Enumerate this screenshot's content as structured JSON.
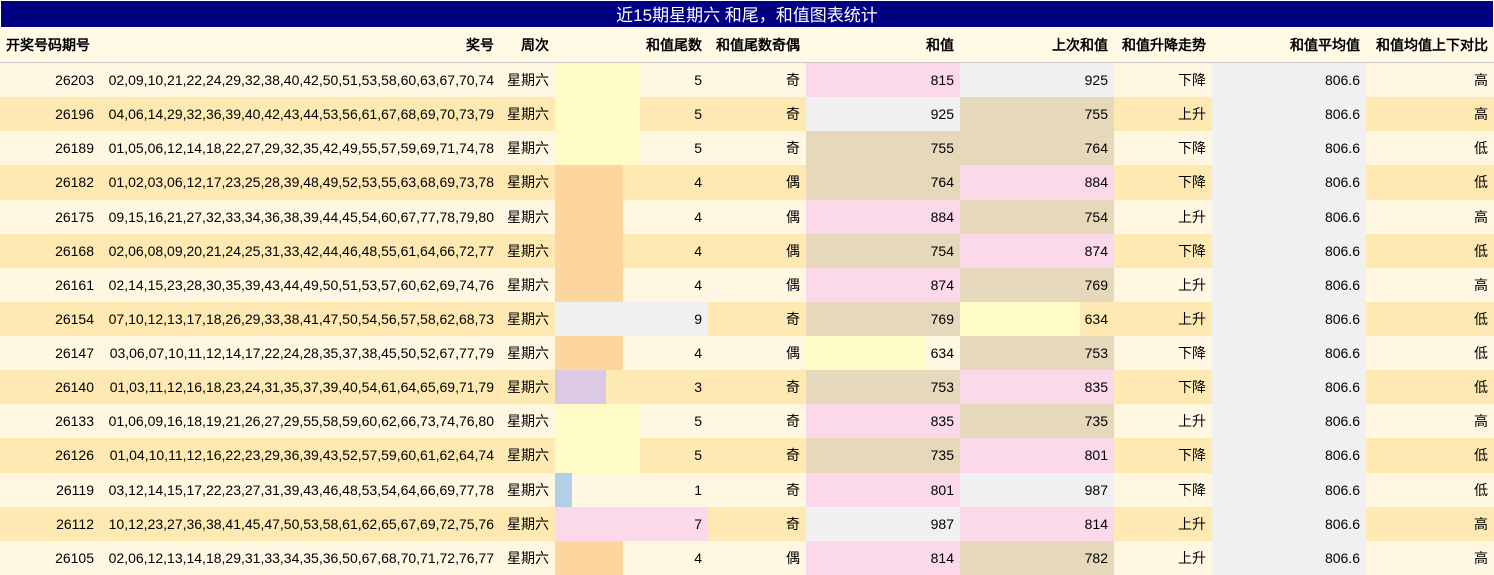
{
  "title": "近15期星期六 和尾，和值图表统计",
  "headers": [
    "开奖号码期号",
    "奖号",
    "周次",
    "",
    "和值尾数",
    "和值尾数奇偶",
    "和值",
    "上次和值",
    "和值升降走势",
    "和值平均值",
    "和值均值上下对比"
  ],
  "colors": {
    "title_bg": "#000080",
    "row_odd": "#fff7e2",
    "row_even": "#fee9b3",
    "tail_1": "#b3cfe6",
    "tail_3": "#dcc9e3",
    "tail_4": "#fdd59e",
    "tail_5": "#fffbc6",
    "tail_7": "#fbd9ea",
    "tail_9": "#f0f0f0",
    "sum_600s": "#fffbc6",
    "sum_700s": "#e6d8bb",
    "sum_800s": "#fbd9ea",
    "sum_900s": "#f0f0f0"
  },
  "rows": [
    {
      "issue": "26203",
      "numbers": "02,09,10,21,22,24,29,32,38,40,42,50,51,53,58,60,63,67,70,74",
      "weekday": "星期六",
      "tail": 5,
      "parity": "奇",
      "sum": 815,
      "prev_sum": 925,
      "trend": "下降",
      "avg": "806.6",
      "compare": "高"
    },
    {
      "issue": "26196",
      "numbers": "04,06,14,29,32,36,39,40,42,43,44,53,56,61,67,68,69,70,73,79",
      "weekday": "星期六",
      "tail": 5,
      "parity": "奇",
      "sum": 925,
      "prev_sum": 755,
      "trend": "上升",
      "avg": "806.6",
      "compare": "高"
    },
    {
      "issue": "26189",
      "numbers": "01,05,06,12,14,18,22,27,29,32,35,42,49,55,57,59,69,71,74,78",
      "weekday": "星期六",
      "tail": 5,
      "parity": "奇",
      "sum": 755,
      "prev_sum": 764,
      "trend": "下降",
      "avg": "806.6",
      "compare": "低"
    },
    {
      "issue": "26182",
      "numbers": "01,02,03,06,12,17,23,25,28,39,48,49,52,53,55,63,68,69,73,78",
      "weekday": "星期六",
      "tail": 4,
      "parity": "偶",
      "sum": 764,
      "prev_sum": 884,
      "trend": "下降",
      "avg": "806.6",
      "compare": "低"
    },
    {
      "issue": "26175",
      "numbers": "09,15,16,21,27,32,33,34,36,38,39,44,45,54,60,67,77,78,79,80",
      "weekday": "星期六",
      "tail": 4,
      "parity": "偶",
      "sum": 884,
      "prev_sum": 754,
      "trend": "上升",
      "avg": "806.6",
      "compare": "高"
    },
    {
      "issue": "26168",
      "numbers": "02,06,08,09,20,21,24,25,31,33,42,44,46,48,55,61,64,66,72,77",
      "weekday": "星期六",
      "tail": 4,
      "parity": "偶",
      "sum": 754,
      "prev_sum": 874,
      "trend": "下降",
      "avg": "806.6",
      "compare": "低"
    },
    {
      "issue": "26161",
      "numbers": "02,14,15,23,28,30,35,39,43,44,49,50,51,53,57,60,62,69,74,76",
      "weekday": "星期六",
      "tail": 4,
      "parity": "偶",
      "sum": 874,
      "prev_sum": 769,
      "trend": "上升",
      "avg": "806.6",
      "compare": "高"
    },
    {
      "issue": "26154",
      "numbers": "07,10,12,13,17,18,26,29,33,38,41,47,50,54,56,57,58,62,68,73",
      "weekday": "星期六",
      "tail": 9,
      "parity": "奇",
      "sum": 769,
      "prev_sum": 634,
      "trend": "上升",
      "avg": "806.6",
      "compare": "低"
    },
    {
      "issue": "26147",
      "numbers": "03,06,07,10,11,12,14,17,22,24,28,35,37,38,45,50,52,67,77,79",
      "weekday": "星期六",
      "tail": 4,
      "parity": "偶",
      "sum": 634,
      "prev_sum": 753,
      "trend": "下降",
      "avg": "806.6",
      "compare": "低"
    },
    {
      "issue": "26140",
      "numbers": "01,03,11,12,16,18,23,24,31,35,37,39,40,54,61,64,65,69,71,79",
      "weekday": "星期六",
      "tail": 3,
      "parity": "奇",
      "sum": 753,
      "prev_sum": 835,
      "trend": "下降",
      "avg": "806.6",
      "compare": "低"
    },
    {
      "issue": "26133",
      "numbers": "01,06,09,16,18,19,21,26,27,29,55,58,59,60,62,66,73,74,76,80",
      "weekday": "星期六",
      "tail": 5,
      "parity": "奇",
      "sum": 835,
      "prev_sum": 735,
      "trend": "上升",
      "avg": "806.6",
      "compare": "高"
    },
    {
      "issue": "26126",
      "numbers": "01,04,10,11,12,16,22,23,29,36,39,43,52,57,59,60,61,62,64,74",
      "weekday": "星期六",
      "tail": 5,
      "parity": "奇",
      "sum": 735,
      "prev_sum": 801,
      "trend": "下降",
      "avg": "806.6",
      "compare": "低"
    },
    {
      "issue": "26119",
      "numbers": "03,12,14,15,17,22,23,27,31,39,43,46,48,53,54,64,66,69,77,78",
      "weekday": "星期六",
      "tail": 1,
      "parity": "奇",
      "sum": 801,
      "prev_sum": 987,
      "trend": "下降",
      "avg": "806.6",
      "compare": "低"
    },
    {
      "issue": "26112",
      "numbers": "10,12,23,27,36,38,41,45,47,50,53,58,61,62,65,67,69,72,75,76",
      "weekday": "星期六",
      "tail": 7,
      "parity": "奇",
      "sum": 987,
      "prev_sum": 814,
      "trend": "上升",
      "avg": "806.6",
      "compare": "高"
    },
    {
      "issue": "26105",
      "numbers": "02,06,12,13,14,18,29,31,33,34,35,36,50,67,68,70,71,72,76,77",
      "weekday": "星期六",
      "tail": 4,
      "parity": "偶",
      "sum": 814,
      "prev_sum": 782,
      "trend": "上升",
      "avg": "806.6",
      "compare": "高"
    }
  ]
}
